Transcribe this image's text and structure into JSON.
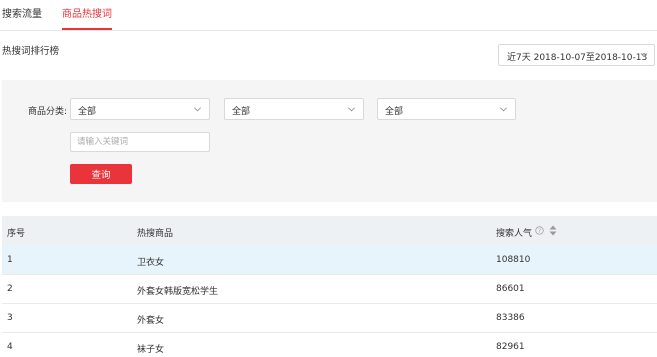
{
  "tabs": [
    {
      "label": "搜索流量",
      "active": false
    },
    {
      "label": "商品热搜词",
      "active": true
    }
  ],
  "accent_color": "#e8343a",
  "section_title": "热搜词排行榜",
  "date_range": "近7天 2018-10-07至2018-10-13",
  "filters": {
    "category_label": "商品分类:",
    "selects": [
      "全部",
      "全部",
      "全部"
    ],
    "keyword_placeholder": "请输入关键词",
    "query_button": "查询"
  },
  "table": {
    "columns": [
      "序号",
      "热搜商品",
      "搜索人气"
    ],
    "rows": [
      {
        "rank": "1",
        "keyword": "卫衣女",
        "popularity": "108810"
      },
      {
        "rank": "2",
        "keyword": "外套女韩版宽松学生",
        "popularity": "86601"
      },
      {
        "rank": "3",
        "keyword": "外套女",
        "popularity": "83386"
      },
      {
        "rank": "4",
        "keyword": "袜子女",
        "popularity": "82961"
      }
    ]
  }
}
